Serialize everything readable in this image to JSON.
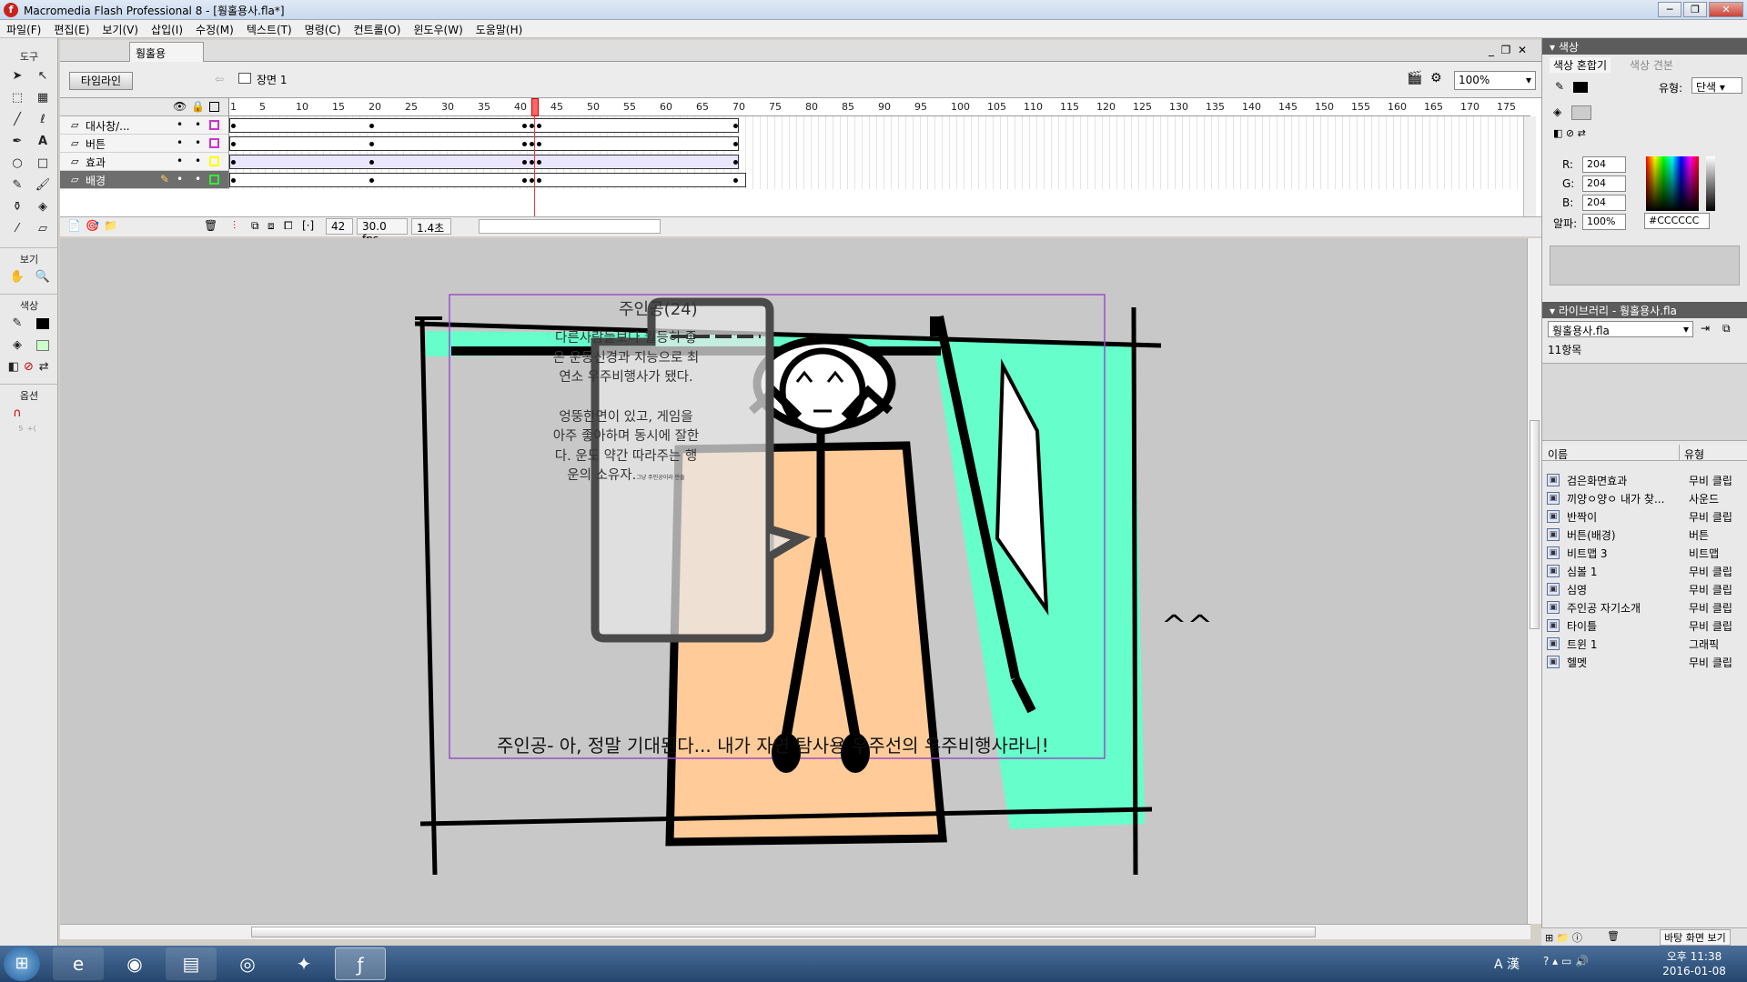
{
  "window": {
    "title": "Macromedia Flash Professional 8 - [훵홀용사.fla*]",
    "minimize": "─",
    "restore": "❐",
    "close": "✕"
  },
  "menu": [
    "파일(F)",
    "편집(E)",
    "보기(V)",
    "삽입(I)",
    "수정(M)",
    "텍스트(T)",
    "명령(C)",
    "컨트롤(O)",
    "윈도우(W)",
    "도움말(H)"
  ],
  "tools": {
    "header": "도구",
    "view_header": "보기",
    "colors_header": "색상",
    "options_header": "옵션"
  },
  "document": {
    "tab": "훵홀용사.fla*",
    "timeline_button": "타임라인",
    "scene": "장면 1",
    "zoom": "100%"
  },
  "timeline": {
    "ruler": [
      "1",
      "5",
      "10",
      "15",
      "20",
      "25",
      "30",
      "35",
      "40",
      "45",
      "50",
      "55",
      "60",
      "65",
      "70",
      "75",
      "80",
      "85",
      "90",
      "95",
      "100",
      "105",
      "110",
      "115",
      "120",
      "125",
      "130",
      "135",
      "140",
      "145",
      "150",
      "155",
      "160",
      "165",
      "170",
      "175"
    ],
    "layers": [
      {
        "name": "대사창/...",
        "color": "#cc33cc",
        "selected": false
      },
      {
        "name": "버튼",
        "color": "#cc33cc",
        "selected": false
      },
      {
        "name": "효과",
        "color": "#ffff00",
        "selected": false
      },
      {
        "name": "배경",
        "color": "#33ee33",
        "selected": true
      }
    ],
    "current_frame": "42",
    "fps": "30.0 fps",
    "time": "1.4초"
  },
  "stage": {
    "bubble_title": "주인공(24)",
    "bubble_text_1": "다른사람들보다 월등히 좋",
    "bubble_text_2": "은 운동신경과 지능으로 최",
    "bubble_text_3": "연소 우주비행사가 됐다.",
    "bubble_text_4": "엉뚱한면이 있고, 게임을",
    "bubble_text_5": "아주 좋아하며 동시에 잘한",
    "bubble_text_6": "다. 운도 약간 따라주는 행",
    "bubble_text_7": "운의 소유자.",
    "bubble_small": "그냥 주인공이라 만들",
    "subtitle": "주인공- 아, 정말 기대된다... 내가 자연 탐사용 우주선의 우주비행사라니!",
    "doodle": "^^"
  },
  "color_panel": {
    "header": "색상",
    "tab_mixer": "색상 혼합기",
    "tab_swatches": "색상 견본",
    "type_label": "유형:",
    "type_value": "단색",
    "r_label": "R:",
    "r": "204",
    "g_label": "G:",
    "g": "204",
    "b_label": "B:",
    "b": "204",
    "alpha_label": "알파:",
    "alpha": "100%",
    "hex": "#CCCCCC"
  },
  "library": {
    "header": "라이브러리 - 훵홀용사.fla",
    "file": "훵홀용사.fla",
    "count": "11항목",
    "col_name": "이름",
    "col_type": "유형",
    "items": [
      {
        "name": "검은화면효과",
        "type": "무비 클립"
      },
      {
        "name": "끼양ㅇ양ㅇ 내가 찾...",
        "type": "사운드"
      },
      {
        "name": "반짝이",
        "type": "무비 클립"
      },
      {
        "name": "버튼(배경)",
        "type": "버튼"
      },
      {
        "name": "비트맵 3",
        "type": "비트맵"
      },
      {
        "name": "심볼 1",
        "type": "무비 클립"
      },
      {
        "name": "심영",
        "type": "무비 클립"
      },
      {
        "name": "주인공 자기소개",
        "type": "무비 클립"
      },
      {
        "name": "타이틀",
        "type": "무비 클립"
      },
      {
        "name": "트윈 1",
        "type": "그래픽"
      },
      {
        "name": "헬멧",
        "type": "무비 클립"
      }
    ],
    "footer_button": "바탕 화면 보기"
  },
  "taskbar": {
    "time": "오후 11:38",
    "date": "2016-01-08",
    "ime": "A 漢"
  },
  "colors": {
    "stage_cyan": "#66ffcc",
    "stage_skin": "#ffcc99",
    "timeline_red": "#ff3333"
  }
}
